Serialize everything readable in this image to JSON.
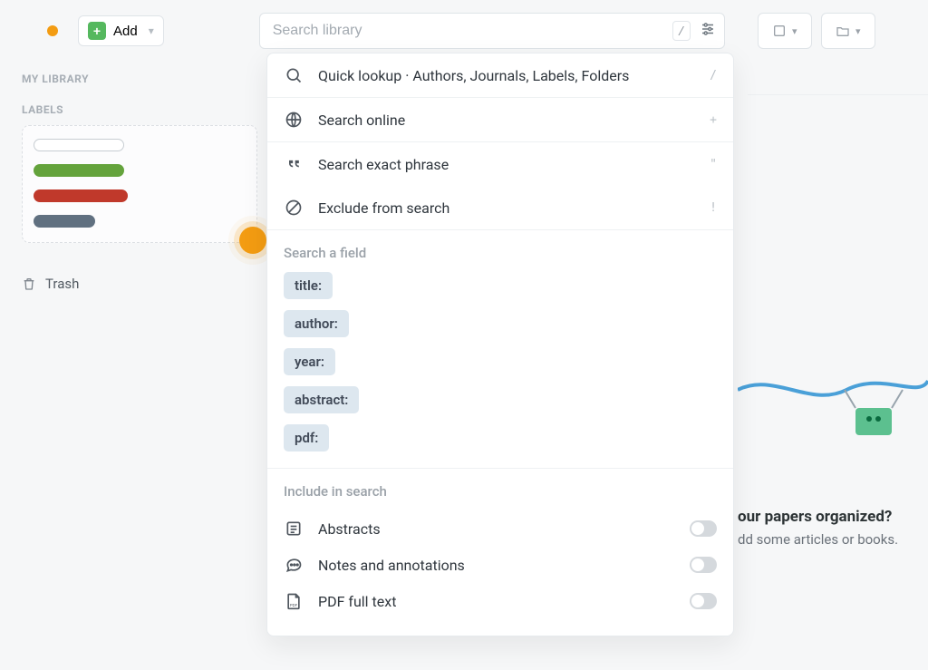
{
  "topbar": {
    "add_label": "Add",
    "search_placeholder": "Search library",
    "search_shortcut": "/",
    "status_color": "#f39c12"
  },
  "sidebar": {
    "heading_library": "MY LIBRARY",
    "heading_labels": "LABELS",
    "label_colors": [
      "skeleton",
      "#64a33c",
      "#c0392b",
      "#607080"
    ],
    "trash_label": "Trash"
  },
  "popover": {
    "options": [
      {
        "icon": "search-icon",
        "label": "Quick lookup · Authors, Journals, Labels, Folders",
        "shortcut": "/"
      },
      {
        "icon": "globe-icon",
        "label": "Search online",
        "shortcut": "+"
      },
      {
        "icon": "quote-icon",
        "label": "Search exact phrase",
        "shortcut": "\""
      },
      {
        "icon": "ban-icon",
        "label": "Exclude from search",
        "shortcut": "!"
      }
    ],
    "fields_heading": "Search a field",
    "fields": [
      "title:",
      "author:",
      "year:",
      "abstract:",
      "pdf:"
    ],
    "include_heading": "Include in search",
    "include": [
      {
        "icon": "abstract-icon",
        "label": "Abstracts",
        "on": false
      },
      {
        "icon": "notes-icon",
        "label": "Notes and annotations",
        "on": false
      },
      {
        "icon": "pdf-icon",
        "label": "PDF full text",
        "on": false
      }
    ]
  },
  "empty": {
    "title": "our papers organized?",
    "subtitle": "dd some articles or books."
  }
}
